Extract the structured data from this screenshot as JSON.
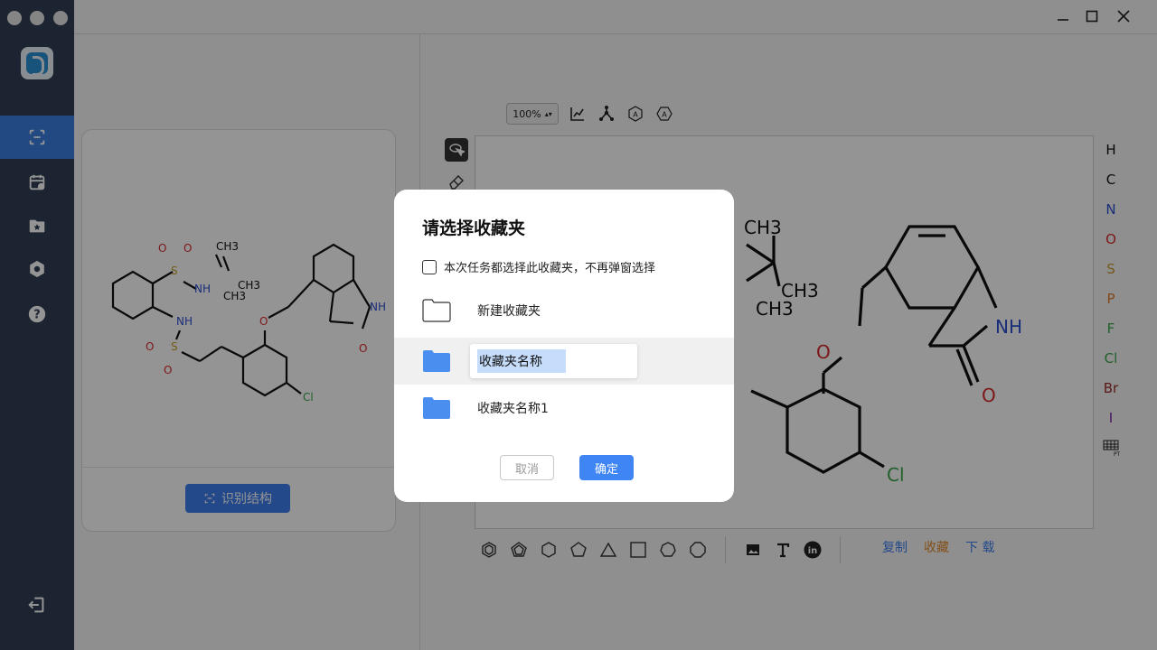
{
  "left_panel": {
    "recognize_button": "识别结构"
  },
  "toolbar": {
    "zoom": "100%"
  },
  "atoms": [
    {
      "symbol": "H",
      "color": "#111111"
    },
    {
      "symbol": "C",
      "color": "#111111"
    },
    {
      "symbol": "N",
      "color": "#2b4fd1"
    },
    {
      "symbol": "O",
      "color": "#d92a2a"
    },
    {
      "symbol": "S",
      "color": "#c89b2a"
    },
    {
      "symbol": "P",
      "color": "#e07a2a"
    },
    {
      "symbol": "F",
      "color": "#3aa54a"
    },
    {
      "symbol": "Cl",
      "color": "#3aa54a"
    },
    {
      "symbol": "Br",
      "color": "#9b2a2a"
    },
    {
      "symbol": "I",
      "color": "#7a2aa0"
    }
  ],
  "bottom_actions": {
    "copy": "复制",
    "favorite": "收藏",
    "download": "下 载"
  },
  "colors": {
    "accent": "#3f86f4",
    "sidebar": "#2f3e54",
    "copy": "#3f7ff0",
    "favorite": "#e0892a",
    "download": "#3f7ff0"
  },
  "dialog": {
    "title": "请选择收藏夹",
    "checkbox_label": "本次任务都选择此收藏夹，不再弹窗选择",
    "new_folder_label": "新建收藏夹",
    "editing_folder_value": "收藏夹名称",
    "folders": [
      "收藏夹名称1"
    ],
    "cancel": "取消",
    "confirm": "确定"
  },
  "molecule_labels": {
    "ch3": "CH3",
    "o": "O",
    "s": "S",
    "nh": "NH",
    "cl": "Cl"
  }
}
